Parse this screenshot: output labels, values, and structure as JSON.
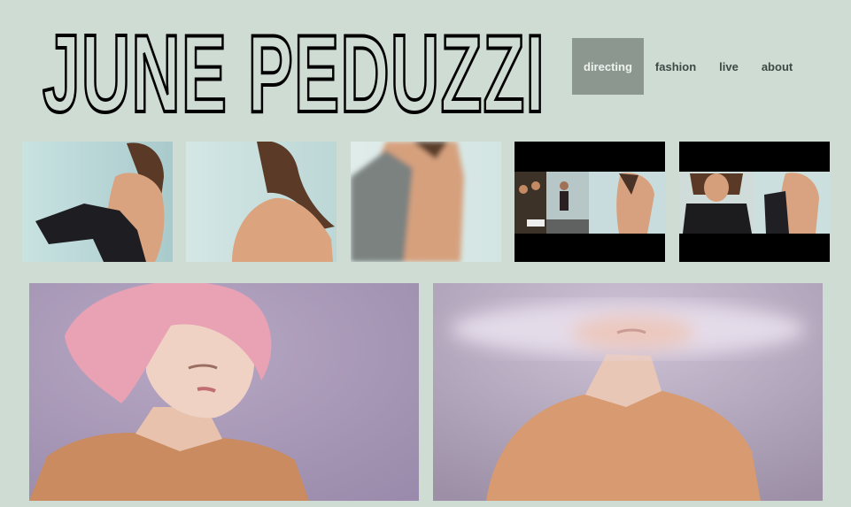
{
  "site": {
    "title": "JUNE PEDUZZI"
  },
  "nav": {
    "items": [
      {
        "label": "directing",
        "active": true
      },
      {
        "label": "fashion",
        "active": false
      },
      {
        "label": "live",
        "active": false
      },
      {
        "label": "about",
        "active": false
      }
    ]
  },
  "colors": {
    "background": "#cfdcd4",
    "nav_active_bg": "#8c988f",
    "nav_text": "#3c4a46",
    "photo_backdrop_purple": "#a89ab8",
    "skin": "#d7a07a",
    "pink_hair": "#eaa2b4",
    "garment_orange": "#d59367"
  }
}
